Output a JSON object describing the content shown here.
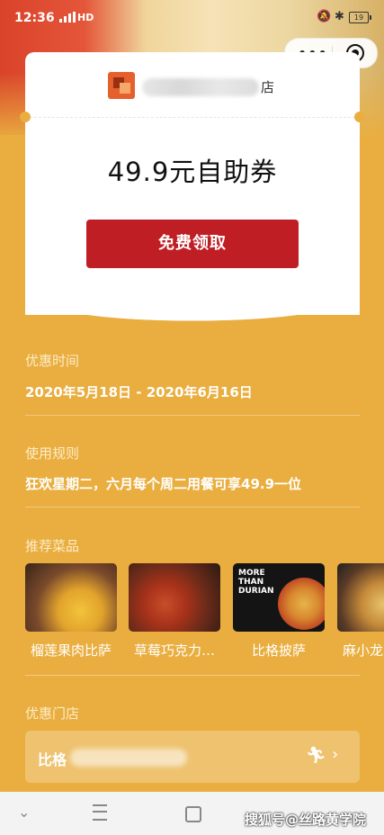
{
  "status_bar": {
    "time": "12:36",
    "network": "HD",
    "battery": "19"
  },
  "capsule": {
    "more_icon": "more-dots-icon",
    "close_icon": "target-close-icon"
  },
  "coupon": {
    "shop_suffix": "店",
    "title": "49.9元自助券",
    "claim_button": "免费领取",
    "colors": {
      "button": "#BF1E25",
      "background": "#E9AE3F"
    }
  },
  "validity": {
    "label": "优惠时间",
    "value": "2020年5月18日 - 2020年6月16日"
  },
  "rules": {
    "label": "使用规则",
    "value": "狂欢星期二，六月每个周二用餐可享49.9一位"
  },
  "recommended": {
    "label": "推荐菜品",
    "dishes": [
      {
        "name": "榴莲果肉比萨"
      },
      {
        "name": "草莓巧克力…"
      },
      {
        "name": "比格披萨",
        "image_text": "MORE THAN DURIAN"
      },
      {
        "name": "麻小龙"
      }
    ]
  },
  "stores": {
    "label": "优惠门店",
    "first_store_prefix": "比格",
    "icons": [
      "walk-icon",
      "chevron-right-icon"
    ]
  },
  "watermark": "搜狐号@丝路黄学院"
}
